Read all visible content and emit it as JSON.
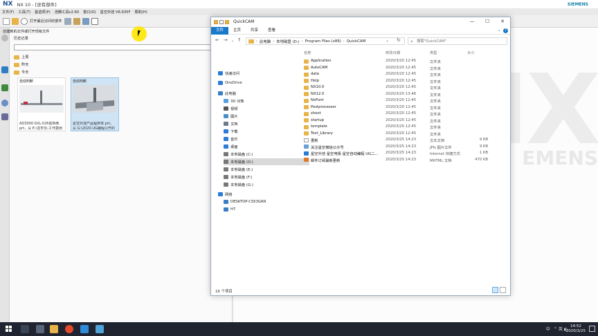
{
  "nx": {
    "logo": "NX",
    "title": "NX 10 - [没有部件]",
    "brand": "SIEMENS",
    "menu": [
      "文件(F)",
      "工具(T)",
      "首选项(P)",
      "浩腾工具v2.60",
      "窗口(O)",
      "星空外挂 V6.935F",
      "帮助(H)"
    ],
    "toolbar_recent": "打开最近访问的部件",
    "history": {
      "header": "创建新的文件或打开现有文件",
      "label": "历史记录",
      "groups": [
        "上周",
        "昨天",
        "今天"
      ],
      "cards": [
        {
          "label": "自动判断",
          "file_line1": "AD3000-SXL-026前挡条.",
          "file_line2": "prt，从 E:\\龙学员-工作案例"
        },
        {
          "label": "自动判断",
          "file_line1": "星空外挂产品程序单.prt，",
          "file_line2": "从 G:\\2020-UG编程公开的"
        }
      ]
    },
    "watermark": "NX",
    "watermark_sub": "EMENS"
  },
  "explorer": {
    "title": "QuickCAM",
    "ribbon_tabs": [
      "文件",
      "主页",
      "共享",
      "查看"
    ],
    "breadcrumb": [
      "此电脑",
      "本地磁盘 (D:)",
      "Program Files (x86)",
      "QuickCAM"
    ],
    "search_placeholder": "搜索\"QuickCAM\"",
    "nav": [
      {
        "label": "快速访问",
        "icon": "star-icon",
        "color": "#2b7bd8"
      },
      {
        "label": "OneDrive",
        "icon": "cloud-icon",
        "color": "#2b7bd8"
      },
      {
        "label": "此电脑",
        "icon": "computer-icon",
        "color": "#3a7fc4"
      },
      {
        "label": "3D 对象",
        "icon": "cube-icon",
        "color": "#5aa0e0"
      },
      {
        "label": "视频",
        "icon": "video-icon",
        "color": "#555"
      },
      {
        "label": "图片",
        "icon": "picture-icon",
        "color": "#4a90c8"
      },
      {
        "label": "文档",
        "icon": "document-icon",
        "color": "#6b7a8a"
      },
      {
        "label": "下载",
        "icon": "download-icon",
        "color": "#2b7bd8"
      },
      {
        "label": "音乐",
        "icon": "music-icon",
        "color": "#2b7bd8"
      },
      {
        "label": "桌面",
        "icon": "desktop-icon",
        "color": "#2b7bd8"
      },
      {
        "label": "本地磁盘 (C:)",
        "icon": "drive-icon",
        "color": "#777"
      },
      {
        "label": "本地磁盘 (D:)",
        "icon": "drive-icon",
        "color": "#777"
      },
      {
        "label": "本地磁盘 (E:)",
        "icon": "drive-icon",
        "color": "#777"
      },
      {
        "label": "本地磁盘 (F:)",
        "icon": "drive-icon",
        "color": "#777"
      },
      {
        "label": "本地磁盘 (G:)",
        "icon": "drive-icon",
        "color": "#777"
      },
      {
        "label": "网络",
        "icon": "network-icon",
        "color": "#2b7bd8"
      },
      {
        "label": "DESKTOP-CS53GRR",
        "icon": "computer-icon",
        "color": "#3a7fc4"
      },
      {
        "label": "H7",
        "icon": "computer-icon",
        "color": "#3a7fc4"
      }
    ],
    "columns": [
      "名称",
      "修改日期",
      "类型",
      "大小"
    ],
    "files": [
      {
        "name": "Application",
        "date": "2020/3/20 12:45",
        "type": "文件夹",
        "size": "",
        "kind": "folder"
      },
      {
        "name": "AutoCAM",
        "date": "2020/3/20 12:45",
        "type": "文件夹",
        "size": "",
        "kind": "folder"
      },
      {
        "name": "data",
        "date": "2020/3/20 12:45",
        "type": "文件夹",
        "size": "",
        "kind": "folder"
      },
      {
        "name": "Help",
        "date": "2020/3/20 12:45",
        "type": "文件夹",
        "size": "",
        "kind": "folder"
      },
      {
        "name": "NX10.0",
        "date": "2020/3/20 12:45",
        "type": "文件夹",
        "size": "",
        "kind": "folder"
      },
      {
        "name": "NX12.0",
        "date": "2020/3/20 13:46",
        "type": "文件夹",
        "size": "",
        "kind": "folder"
      },
      {
        "name": "NxFont",
        "date": "2020/3/20 12:45",
        "type": "文件夹",
        "size": "",
        "kind": "folder"
      },
      {
        "name": "Postprocessor",
        "date": "2020/3/20 12:45",
        "type": "文件夹",
        "size": "",
        "kind": "folder"
      },
      {
        "name": "sheet",
        "date": "2020/3/20 12:45",
        "type": "文件夹",
        "size": "",
        "kind": "folder"
      },
      {
        "name": "startup",
        "date": "2020/3/20 12:45",
        "type": "文件夹",
        "size": "",
        "kind": "folder"
      },
      {
        "name": "template",
        "date": "2020/3/20 12:45",
        "type": "文件夹",
        "size": "",
        "kind": "folder"
      },
      {
        "name": "Text_Library",
        "date": "2020/3/20 12:45",
        "type": "文件夹",
        "size": "",
        "kind": "folder"
      },
      {
        "name": "更新",
        "date": "2020/3/25 14:23",
        "type": "文本文档",
        "size": "9 KB",
        "kind": "text"
      },
      {
        "name": "关注星空微信公众号",
        "date": "2020/3/25 14:23",
        "type": "JPG 图片文件",
        "size": "9 KB",
        "kind": "image"
      },
      {
        "name": "星空外挂 星空电极 星空自动编程 UG二...",
        "date": "2020/3/25 14:23",
        "type": "Internet 快捷方式",
        "size": "1 KB",
        "kind": "link"
      },
      {
        "name": "邮件订阅最新更新",
        "date": "2020/3/25 14:23",
        "type": "MHTML 文档",
        "size": "470 KB",
        "kind": "mhtml"
      }
    ],
    "status": "16 个项目"
  },
  "taskbar": {
    "tray_lang": "中",
    "tray_glyphs": "^ 英 ◐",
    "time": "14:52",
    "date": "2020/3/25"
  },
  "colors": {
    "accent": "#1979ca",
    "folder": "#e8b44a",
    "taskbar": "#1f2430"
  }
}
